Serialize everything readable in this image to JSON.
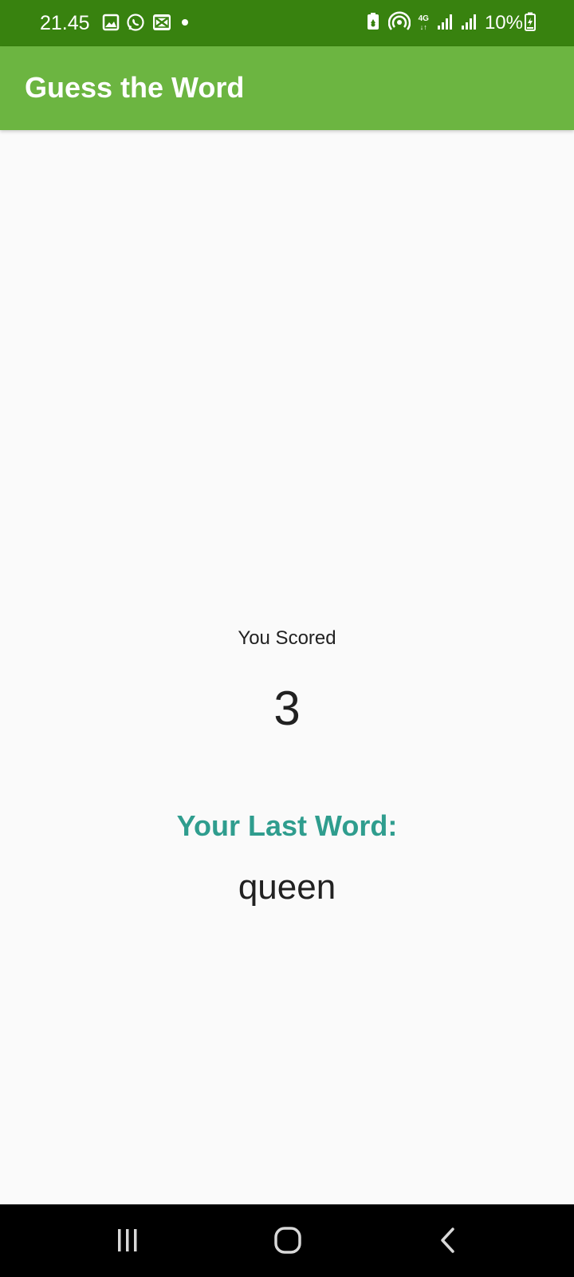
{
  "status_bar": {
    "time": "21.45",
    "battery": "10%",
    "network": "4G",
    "icons_left": [
      "gallery-icon",
      "whatsapp-icon",
      "capcut-icon",
      "dot-icon"
    ],
    "icons_right": [
      "battery-saver-icon",
      "hotspot-icon",
      "network-4g-icon",
      "signal-icon",
      "signal-icon",
      "battery-charging-icon"
    ],
    "background": "#38820f"
  },
  "app_bar": {
    "title": "Guess the Word",
    "background": "#6cb541"
  },
  "score": {
    "label": "You Scored",
    "value": "3"
  },
  "last_word": {
    "label": "Your Last Word:",
    "value": "queen",
    "label_color": "#2f9d8e"
  },
  "nav_bar": {
    "buttons": [
      "recents-icon",
      "home-icon",
      "back-icon"
    ]
  }
}
